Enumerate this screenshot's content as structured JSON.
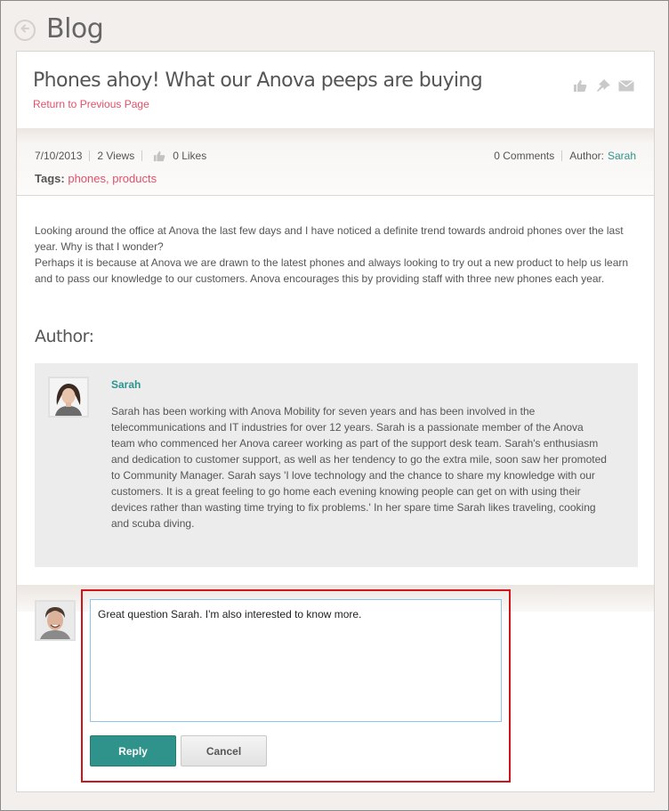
{
  "header": {
    "title": "Blog",
    "back_icon": "back-arrow-icon"
  },
  "post": {
    "title": "Phones ahoy! What our Anova peeps are buying",
    "return_link": "Return to Previous Page",
    "actions": [
      "like-icon",
      "pin-icon",
      "email-icon"
    ],
    "date": "7/10/2013",
    "views": "2 Views",
    "likes": "0 Likes",
    "comments": "0 Comments",
    "author_label": "Author:",
    "author_name": "Sarah",
    "tags_label": "Tags:",
    "tags": [
      "phones",
      "products"
    ],
    "tag_separator": ",",
    "body": [
      "Looking around the office at Anova the last few days and I have noticed a definite trend towards android phones over the last year. Why is that I wonder?",
      "Perhaps it is because at Anova we are drawn to the latest phones and always looking to try out a new product to help us learn and to pass our knowledge to our customers. Anova encourages this by providing staff with three new phones each year."
    ]
  },
  "author_section": {
    "heading": "Author:",
    "name": "Sarah",
    "bio": "Sarah has been working with Anova Mobility for seven years and has been involved in the telecommunications and IT industries for over 12 years. Sarah is a passionate member of the Anova team who commenced her Anova career working as part of the support desk team. Sarah's enthusiasm and dedication to customer support, as well as her tendency to go the extra mile, soon saw her promoted to Community Manager. Sarah says 'I love technology and the chance to share my knowledge with our customers. It is a great feeling to go home each evening knowing people can get on with using their devices rather than wasting time trying to fix problems.' In her spare time Sarah likes traveling, cooking and scuba diving."
  },
  "reply": {
    "value": "Great question Sarah. I'm also interested to know more.",
    "reply_label": "Reply",
    "cancel_label": "Cancel"
  },
  "colors": {
    "accent": "#2f938c",
    "link": "#e0506a",
    "highlight": "#d0141c",
    "background": "#f3efec"
  }
}
